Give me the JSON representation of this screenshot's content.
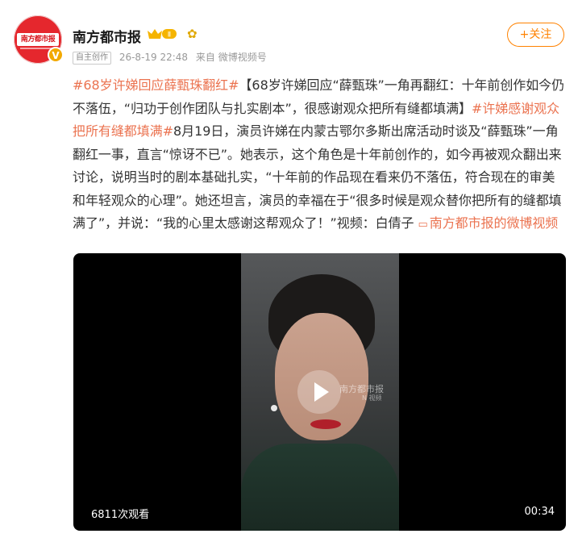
{
  "account": {
    "name": "南方都市报",
    "avatar_text": "南方都市报",
    "vip_level": "Ⅱ",
    "follow_label": "+关注"
  },
  "meta": {
    "tag": "自主创作",
    "time": "26-8-19 22:48",
    "from": "来自",
    "source": "微博视频号"
  },
  "post": {
    "hashtag1": "#68岁许娣回应薛甄珠翻红#",
    "text1": "【68岁许娣回应“薛甄珠”一角再翻红：十年前创作如今仍不落伍，“归功于创作团队与扎实剧本”，很感谢观众把所有缝都填满】",
    "hashtag2": "#许娣感谢观众把所有缝都填满#",
    "text2": "8月19日，演员许娣在内蒙古鄂尔多斯出席活动时谈及“薛甄珠”一角翻红一事，直言“惊讶不已”。她表示，这个角色是十年前创作的，如今再被观众翻出来讨论，说明当时的剧本基础扎实，“十年前的作品现在看来仍不落伍，符合现在的审美和年轻观众的心理”。她还坦言，演员的幸福在于“很多时候是观众替你把所有的缝都填满了”，并说：“我的心里太感谢这帮观众了！”视频：白倩子",
    "link_text": "南方都市报的微博视频"
  },
  "video": {
    "views": "6811次观看",
    "duration": "00:34",
    "watermark": "南方都市报",
    "watermark_sub": "N 视频"
  },
  "colors": {
    "accent": "#ff8200",
    "hashtag": "#eb7350"
  }
}
